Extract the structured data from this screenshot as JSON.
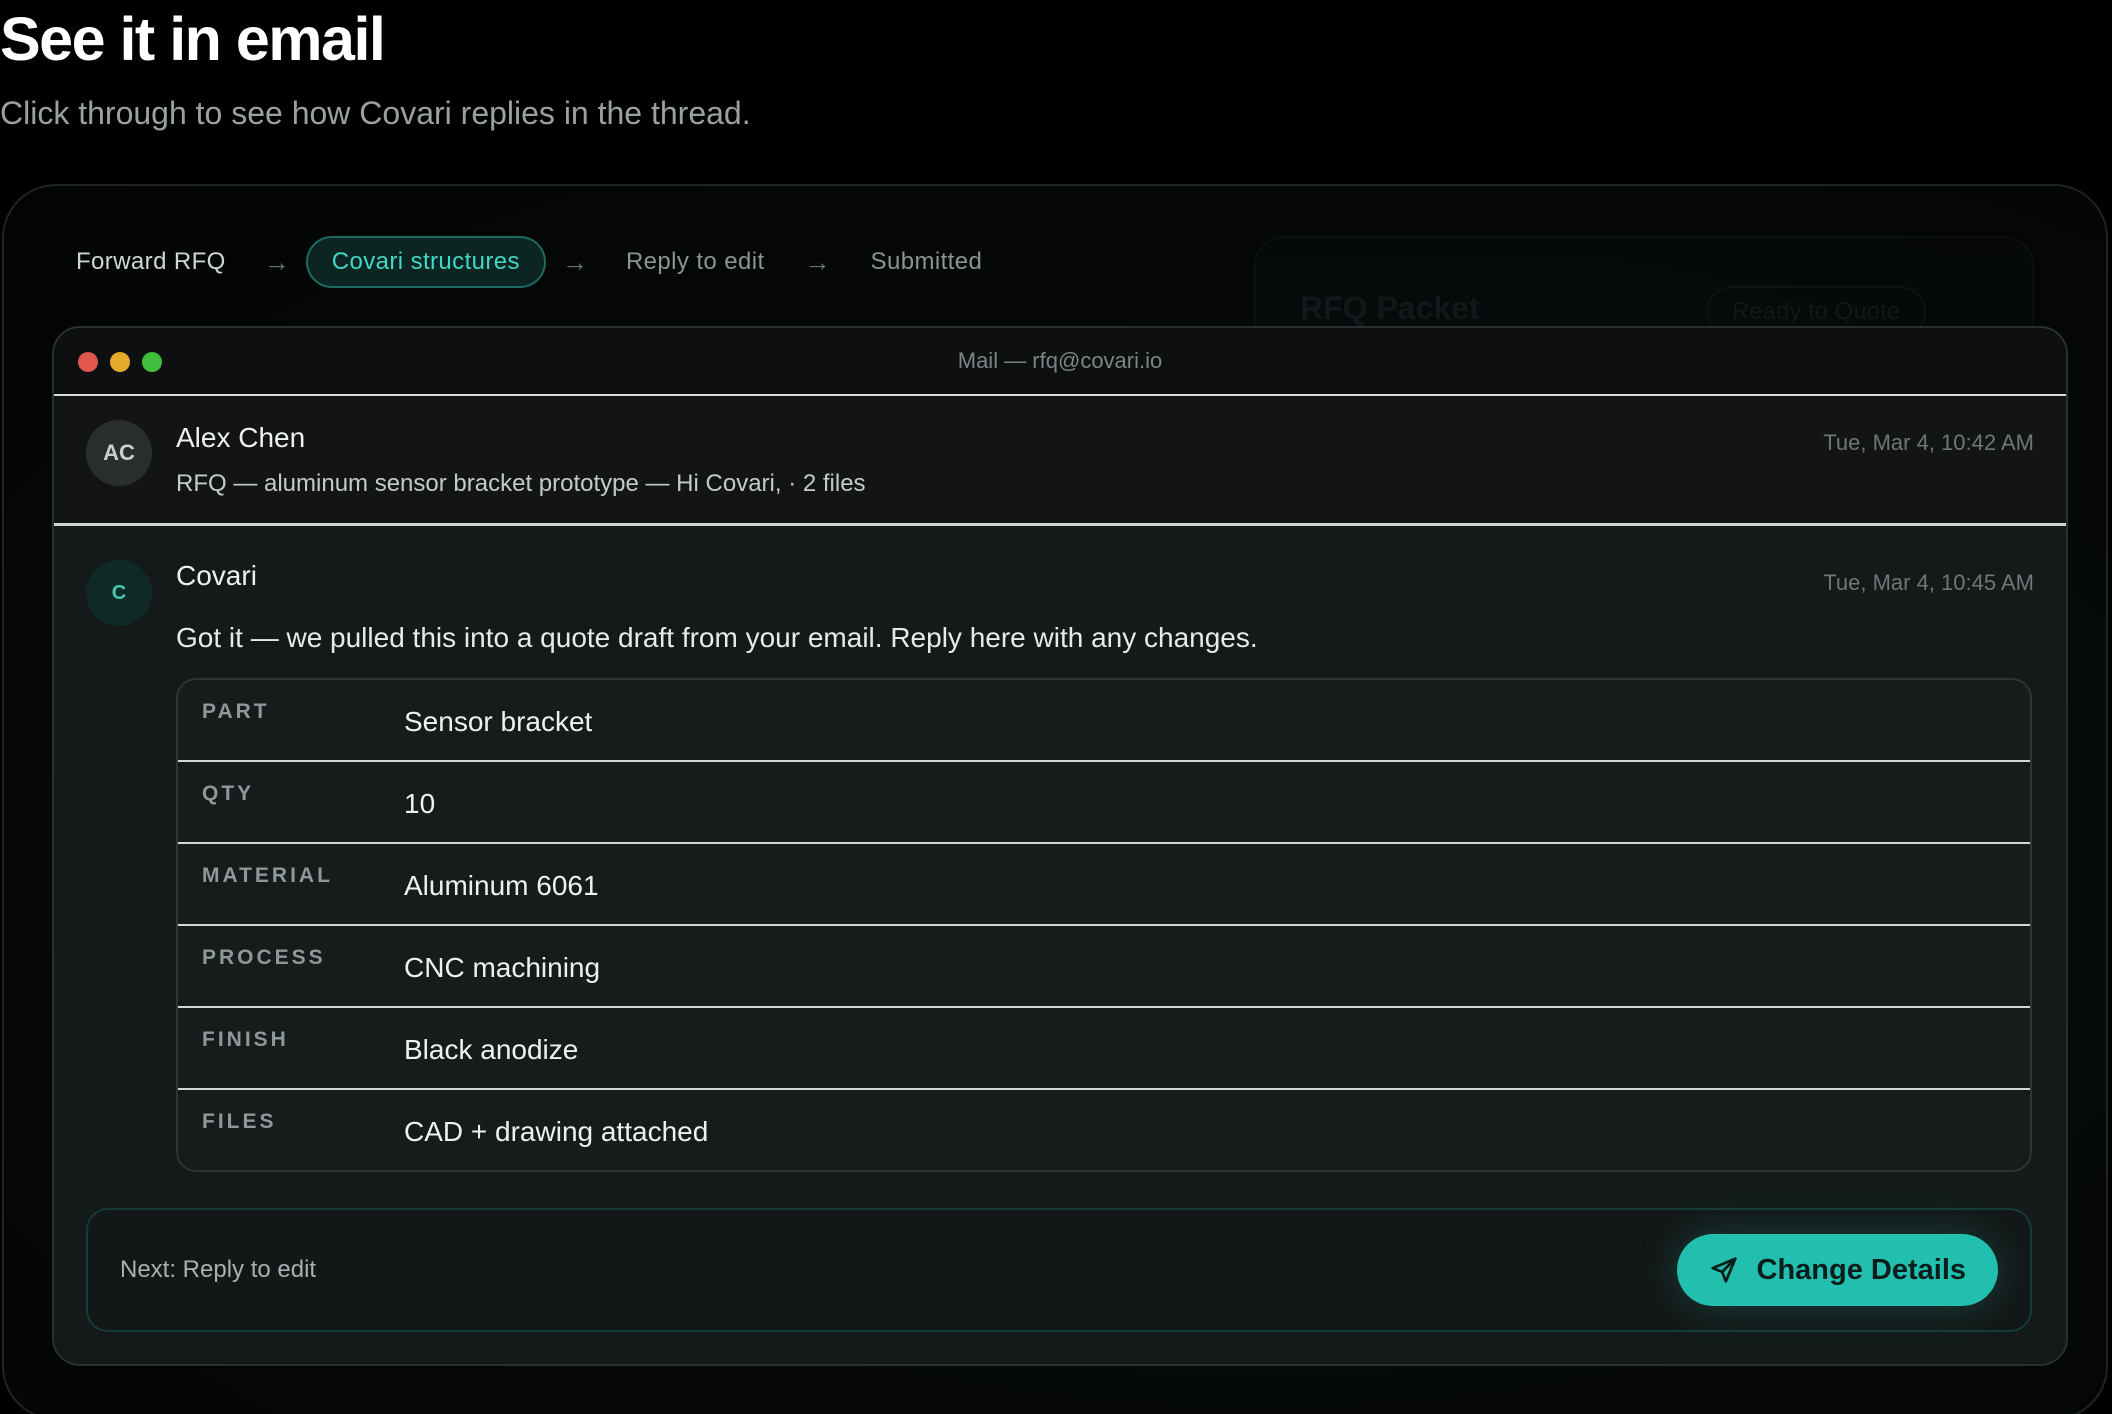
{
  "hero": {
    "title": "See it in email",
    "subtitle": "Click through to see how Covari replies in the thread."
  },
  "steps": [
    {
      "label": "Forward RFQ",
      "state": "done"
    },
    {
      "label": "Covari structures",
      "state": "active"
    },
    {
      "label": "Reply to edit",
      "state": "upcoming"
    },
    {
      "label": "Submitted",
      "state": "upcoming"
    }
  ],
  "background_card": {
    "title": "RFQ Packet",
    "badge": "Ready to Quote"
  },
  "mail_window": {
    "title": "Mail — rfq@covari.io",
    "incoming": {
      "avatar_initials": "AC",
      "sender": "Alex Chen",
      "snippet": "RFQ — aluminum sensor bracket prototype — Hi Covari, · 2 files",
      "time": "Tue, Mar 4, 10:42 AM"
    },
    "reply": {
      "avatar_initials": "C",
      "sender": "Covari",
      "time": "Tue, Mar 4, 10:45 AM",
      "body": "Got it — we pulled this into a quote draft from your email. Reply here with any changes.",
      "fields": [
        {
          "key": "PART",
          "value": "Sensor bracket"
        },
        {
          "key": "QTY",
          "value": "10"
        },
        {
          "key": "MATERIAL",
          "value": "Aluminum 6061"
        },
        {
          "key": "PROCESS",
          "value": "CNC machining"
        },
        {
          "key": "FINISH",
          "value": "Black anodize"
        },
        {
          "key": "FILES",
          "value": "CAD + drawing attached"
        }
      ]
    },
    "next_bar": {
      "label": "Next: Reply to edit",
      "button_label": "Change Details",
      "button_icon": "send-icon"
    }
  },
  "colors": {
    "accent": "#22bfae",
    "accent_text": "#3fd7c5",
    "background": "#000000"
  }
}
